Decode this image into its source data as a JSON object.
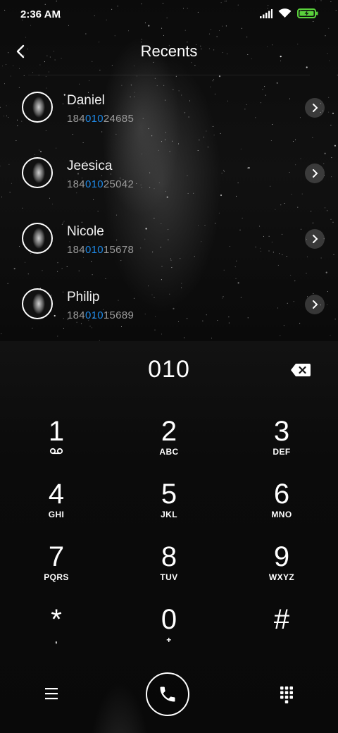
{
  "status_bar": {
    "time": "2:36 AM"
  },
  "header": {
    "title": "Recents"
  },
  "contacts": [
    {
      "name": "Daniel",
      "number_prefix": "184",
      "number_match": "010",
      "number_suffix": "24685"
    },
    {
      "name": "Jeesica",
      "number_prefix": "184",
      "number_match": "010",
      "number_suffix": "25042"
    },
    {
      "name": "Nicole",
      "number_prefix": "184",
      "number_match": "010",
      "number_suffix": "15678"
    },
    {
      "name": "Philip",
      "number_prefix": "184",
      "number_match": "010",
      "number_suffix": "15689"
    }
  ],
  "dialer": {
    "input": "010"
  },
  "keypad": {
    "k1": {
      "digit": "1",
      "letters": ""
    },
    "k2": {
      "digit": "2",
      "letters": "ABC"
    },
    "k3": {
      "digit": "3",
      "letters": "DEF"
    },
    "k4": {
      "digit": "4",
      "letters": "GHI"
    },
    "k5": {
      "digit": "5",
      "letters": "JKL"
    },
    "k6": {
      "digit": "6",
      "letters": "MNO"
    },
    "k7": {
      "digit": "7",
      "letters": "PQRS"
    },
    "k8": {
      "digit": "8",
      "letters": "TUV"
    },
    "k9": {
      "digit": "9",
      "letters": "WXYZ"
    },
    "kstar": {
      "digit": "*",
      "letters": ","
    },
    "k0": {
      "digit": "0",
      "letters": "+"
    },
    "khash": {
      "digit": "#",
      "letters": ""
    }
  },
  "icons": {
    "back": "chevron-left-icon",
    "voicemail": "voicemail-icon",
    "backspace": "backspace-icon",
    "menu": "menu-icon",
    "call": "phone-icon",
    "keypad": "keypad-icon",
    "signal": "signal-icon",
    "wifi": "wifi-icon",
    "battery": "battery-charging-icon"
  },
  "colors": {
    "match_highlight": "#1e88e5",
    "battery": "#5ad13c"
  }
}
